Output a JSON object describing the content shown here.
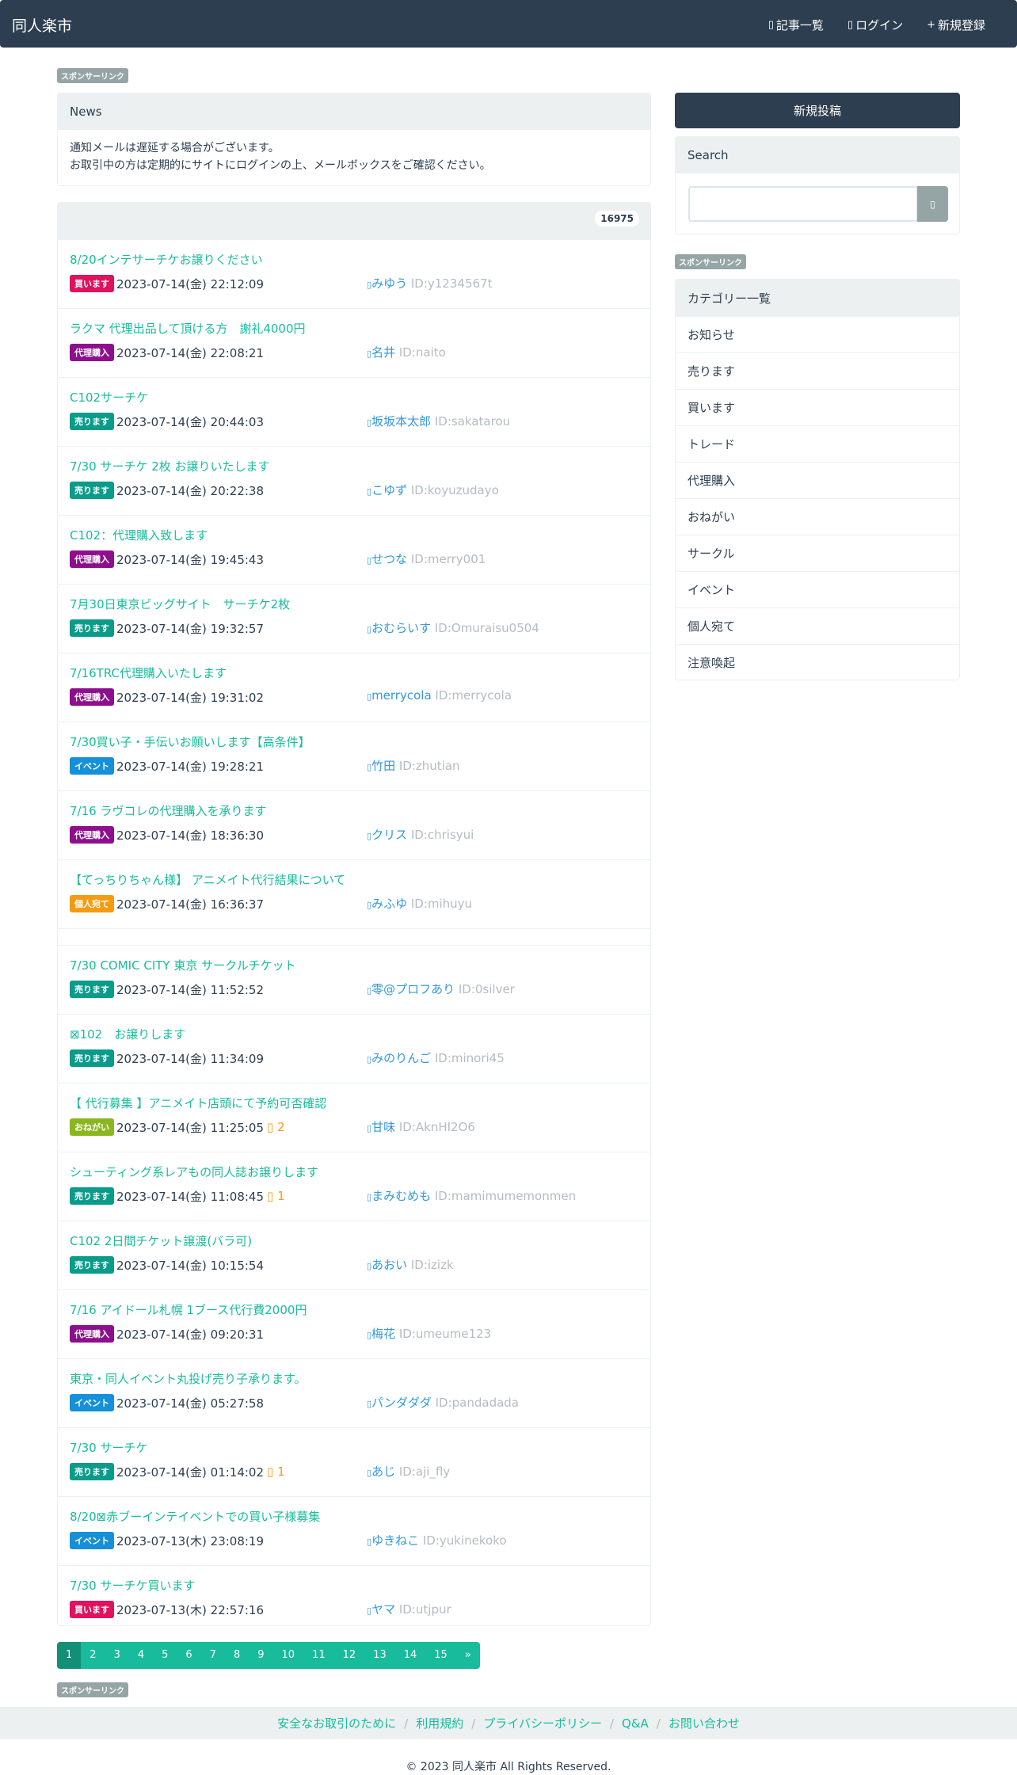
{
  "nav": {
    "brand": "同人楽市",
    "links": [
      {
        "icon": "list-icon",
        "glyph": "▯",
        "label": "記事一覧"
      },
      {
        "icon": "login-icon",
        "glyph": "▯",
        "label": "ログイン"
      },
      {
        "icon": "plus-icon",
        "glyph": "+",
        "label": "新規登録"
      }
    ]
  },
  "sponsor_label": "スポンサーリンク",
  "news": {
    "heading": "News",
    "lines": [
      "通知メールは遅延する場合がございます。",
      "お取引中の方は定期的にサイトにログインの上、メールボックスをご確認ください。"
    ]
  },
  "posts_panel": {
    "count": "16975"
  },
  "label_colors": {
    "買います": "#e0115f",
    "代理購入": "#8e0f8e",
    "売ります": "#0b9b8a",
    "イベント": "#1690d8",
    "個人宛て": "#f39c12",
    "おねがい": "#8cb61e"
  },
  "posts": [
    {
      "title": "8/20インテサーチケお譲りください",
      "label": "買います",
      "date": "2023-07-14(金) 22:12:09",
      "comments": "",
      "user": "みゆう",
      "uid": "ID:y1234567t"
    },
    {
      "title": "ラクマ 代理出品して頂ける方　謝礼4000円",
      "label": "代理購入",
      "date": "2023-07-14(金) 22:08:21",
      "comments": "",
      "user": "名井",
      "uid": "ID:naito"
    },
    {
      "title": "C102サーチケ",
      "label": "売ります",
      "date": "2023-07-14(金) 20:44:03",
      "comments": "",
      "user": "坂坂本太郎",
      "uid": "ID:sakatarou"
    },
    {
      "title": "7/30 サーチケ 2枚 お譲りいたします",
      "label": "売ります",
      "date": "2023-07-14(金) 20:22:38",
      "comments": "",
      "user": "こゆず",
      "uid": "ID:koyuzudayo"
    },
    {
      "title": "C102：代理購入致します",
      "label": "代理購入",
      "date": "2023-07-14(金) 19:45:43",
      "comments": "",
      "user": "せつな",
      "uid": "ID:merry001"
    },
    {
      "title": "7月30日東京ビッグサイト　サーチケ2枚",
      "label": "売ります",
      "date": "2023-07-14(金) 19:32:57",
      "comments": "",
      "user": "おむらいす",
      "uid": "ID:Omuraisu0504"
    },
    {
      "title": "7/16TRC代理購入いたします",
      "label": "代理購入",
      "date": "2023-07-14(金) 19:31:02",
      "comments": "",
      "user": "merrycola",
      "uid": "ID:merrycola"
    },
    {
      "title": "7/30買い子・手伝いお願いします【高条件】",
      "label": "イベント",
      "date": "2023-07-14(金) 19:28:21",
      "comments": "",
      "user": "竹田",
      "uid": "ID:zhutian"
    },
    {
      "title": "7/16 ラヴコレの代理購入を承ります",
      "label": "代理購入",
      "date": "2023-07-14(金) 18:36:30",
      "comments": "",
      "user": "クリス",
      "uid": "ID:chrisyui"
    },
    {
      "title": "【てっちりちゃん様】 アニメイト代行結果について",
      "label": "個人宛て",
      "date": "2023-07-14(金) 16:36:37",
      "comments": "",
      "user": "みふゆ",
      "uid": "ID:mihuyu"
    },
    {
      "title": "7/30 COMIC CITY 東京 サークルチケット",
      "label": "売ります",
      "date": "2023-07-14(金) 11:52:52",
      "comments": "",
      "user": "零@プロフあり",
      "uid": "ID:0silver"
    },
    {
      "title": "⊠102　お譲りします",
      "label": "売ります",
      "date": "2023-07-14(金) 11:34:09",
      "comments": "",
      "user": "みのりんご",
      "uid": "ID:minori45"
    },
    {
      "title": "【 代行募集 】アニメイト店頭にて予約可否確認",
      "label": "おねがい",
      "date": "2023-07-14(金) 11:25:05",
      "comments": "2",
      "user": "甘味",
      "uid": "ID:AknHI2O6"
    },
    {
      "title": "シューティング系レアもの同人誌お譲りします",
      "label": "売ります",
      "date": "2023-07-14(金) 11:08:45",
      "comments": "1",
      "user": "まみむめも",
      "uid": "ID:mamimumemonmen"
    },
    {
      "title": "C102 2日間チケット譲渡(バラ可)",
      "label": "売ります",
      "date": "2023-07-14(金) 10:15:54",
      "comments": "",
      "user": "あおい",
      "uid": "ID:izizk"
    },
    {
      "title": "7/16 アイドール札幌 1ブース代行費2000円",
      "label": "代理購入",
      "date": "2023-07-14(金) 09:20:31",
      "comments": "",
      "user": "梅花",
      "uid": "ID:umeume123"
    },
    {
      "title": "東京・同人イベント丸投げ売り子承ります。",
      "label": "イベント",
      "date": "2023-07-14(金) 05:27:58",
      "comments": "",
      "user": "パンダダダ",
      "uid": "ID:pandadada"
    },
    {
      "title": "7/30 サーチケ",
      "label": "売ります",
      "date": "2023-07-14(金) 01:14:02",
      "comments": "1",
      "user": "あじ",
      "uid": "ID:aji_fly"
    },
    {
      "title": "8/20⊠赤ブーインテイベントでの買い子様募集",
      "label": "イベント",
      "date": "2023-07-13(木) 23:08:19",
      "comments": "",
      "user": "ゆきねこ",
      "uid": "ID:yukinekoko"
    },
    {
      "title": "7/30 サーチケ買います",
      "label": "買います",
      "date": "2023-07-13(木) 22:57:16",
      "comments": "",
      "user": "ヤマ",
      "uid": "ID:utjpur"
    }
  ],
  "pagination": [
    "1",
    "2",
    "3",
    "4",
    "5",
    "6",
    "7",
    "8",
    "9",
    "10",
    "11",
    "12",
    "13",
    "14",
    "15",
    "»"
  ],
  "sidebar": {
    "new_post": "新規投稿",
    "search_heading": "Search",
    "search_button_glyph": "▯",
    "categories_heading": "カテゴリー一覧",
    "categories": [
      "お知らせ",
      "売ります",
      "買います",
      "トレード",
      "代理購入",
      "おねがい",
      "サークル",
      "イベント",
      "個人宛て",
      "注意喚起"
    ]
  },
  "footer": {
    "links": [
      "安全なお取引のために",
      "利用規約",
      "プライバシーポリシー",
      "Q&A",
      "お問い合わせ"
    ],
    "separator": "/",
    "copyright": "© 2023 同人楽市 All Rights Reserved."
  }
}
